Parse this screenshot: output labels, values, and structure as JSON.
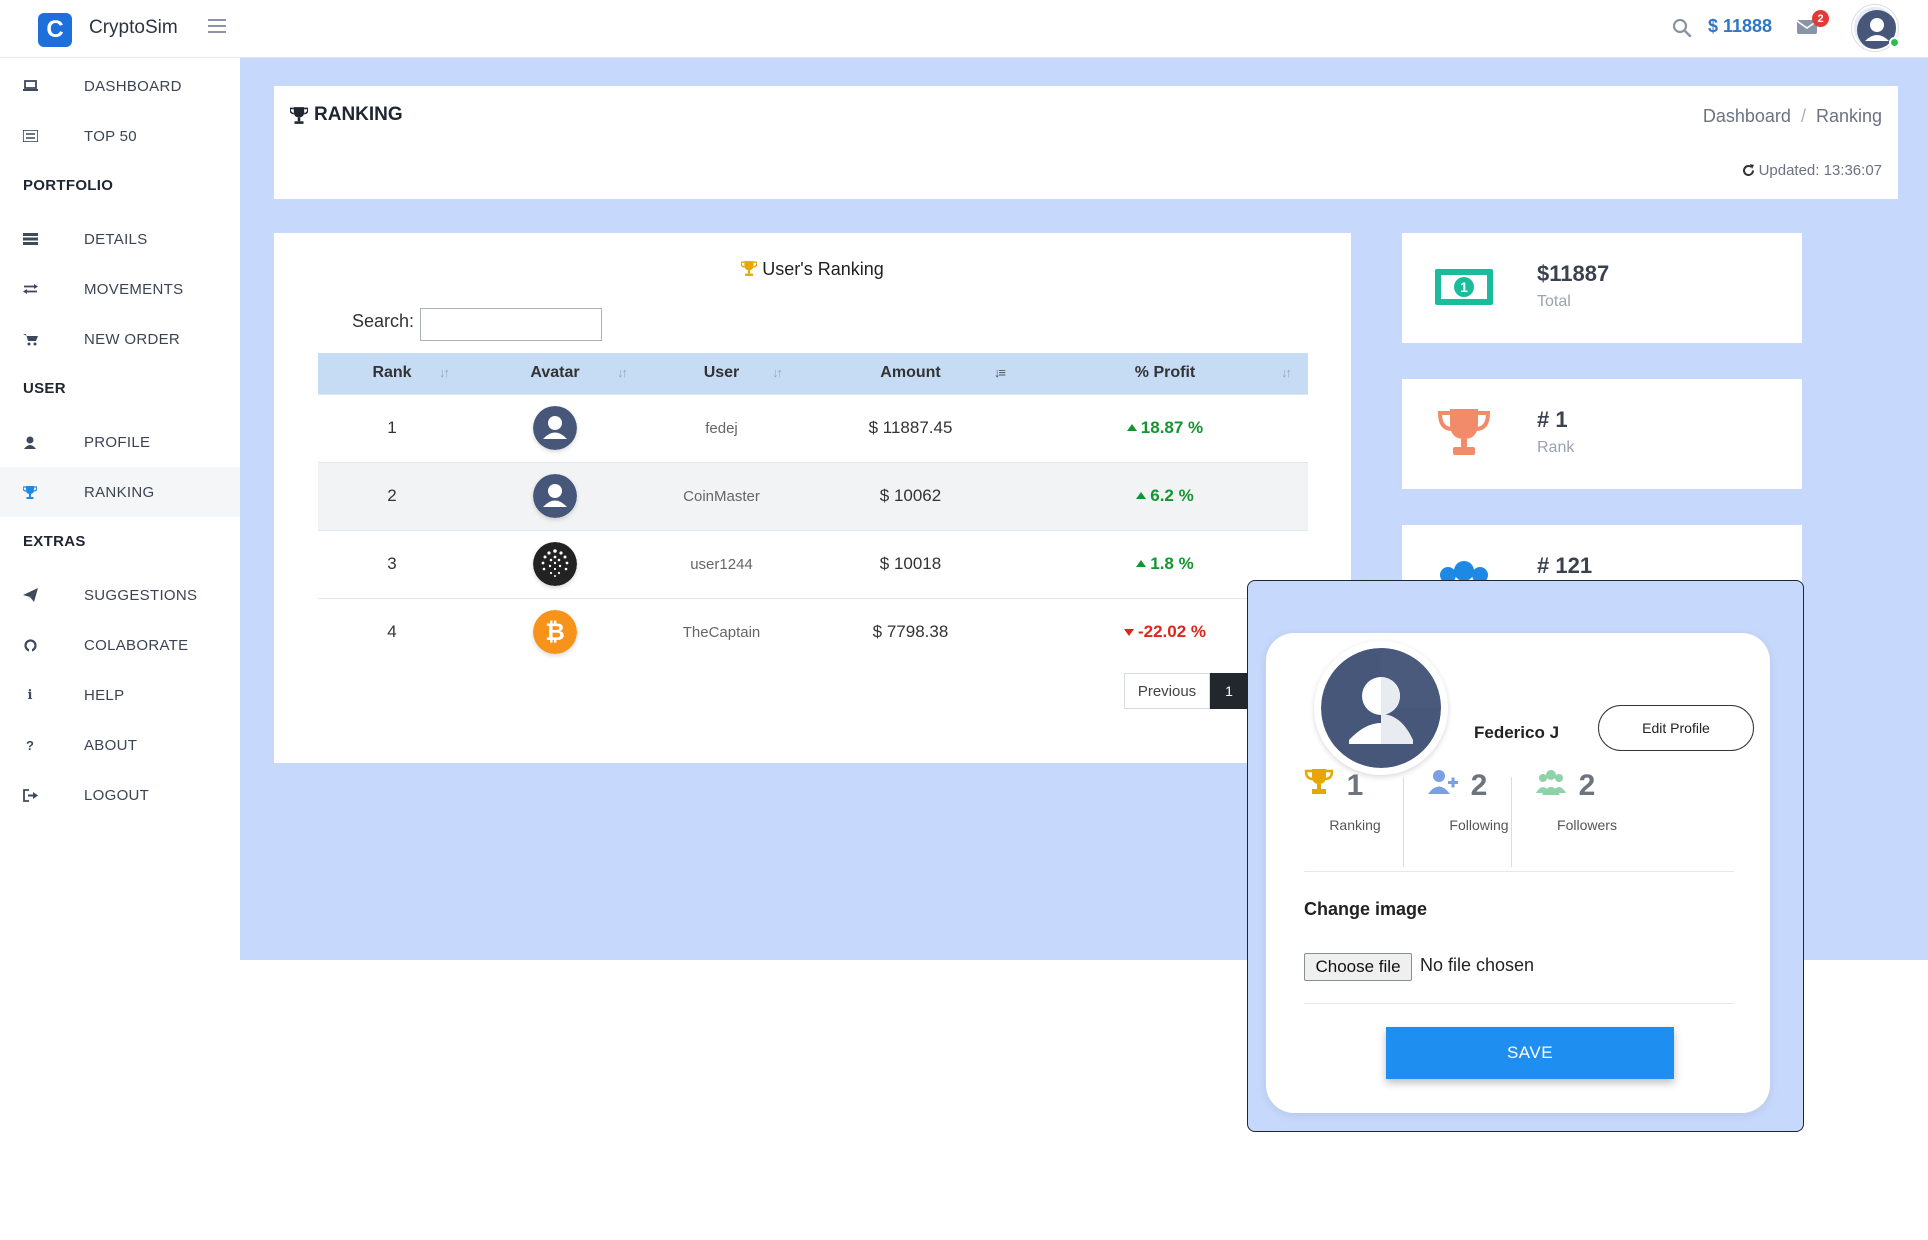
{
  "app": {
    "name": "CryptoSim",
    "logo_letter": "C",
    "brand_color": "#1e6fd9"
  },
  "topbar": {
    "balance": "$ 11888",
    "mail_count": "2"
  },
  "sidebar": {
    "items": [
      {
        "label": "DASHBOARD",
        "icon": "laptop-icon"
      },
      {
        "label": "TOP 50",
        "icon": "list-icon"
      }
    ],
    "sections": [
      {
        "title": "PORTFOLIO",
        "items": [
          {
            "label": "DETAILS",
            "icon": "tasks-icon"
          },
          {
            "label": "MOVEMENTS",
            "icon": "exchange-icon"
          },
          {
            "label": "NEW ORDER",
            "icon": "cart-icon"
          }
        ]
      },
      {
        "title": "USER",
        "items": [
          {
            "label": "PROFILE",
            "icon": "user-icon"
          },
          {
            "label": "RANKING",
            "icon": "trophy-icon",
            "active": true
          }
        ]
      },
      {
        "title": "EXTRAS",
        "items": [
          {
            "label": "SUGGESTIONS",
            "icon": "paper-plane-icon"
          },
          {
            "label": "COLABORATE",
            "icon": "github-icon"
          },
          {
            "label": "HELP",
            "icon": "info-icon"
          },
          {
            "label": "ABOUT",
            "icon": "question-icon"
          },
          {
            "label": "LOGOUT",
            "icon": "sign-out-icon"
          }
        ]
      }
    ]
  },
  "header": {
    "title": "RANKING",
    "breadcrumb": [
      "Dashboard",
      "Ranking"
    ],
    "breadcrumb_sep": "/",
    "updated": "Updated: 13:36:07"
  },
  "ranking_table": {
    "title": "User's Ranking",
    "search_label": "Search:",
    "search_value": "",
    "columns": [
      "Rank",
      "Avatar",
      "User",
      "Amount",
      "% Profit"
    ],
    "rows": [
      {
        "rank": "1",
        "avatar": "default-user",
        "user": "fedej",
        "amount": "$ 11887.45",
        "profit": "18.87 %",
        "trend": "up"
      },
      {
        "rank": "2",
        "avatar": "default-user",
        "user": "CoinMaster",
        "amount": "$ 10062",
        "profit": "6.2 %",
        "trend": "up"
      },
      {
        "rank": "3",
        "avatar": "iota-coin",
        "user": "user1244",
        "amount": "$ 10018",
        "profit": "1.8 %",
        "trend": "up"
      },
      {
        "rank": "4",
        "avatar": "bitcoin-coin",
        "user": "TheCaptain",
        "amount": "$ 7798.38",
        "profit": "-22.02 %",
        "trend": "down"
      }
    ],
    "pager": {
      "previous": "Previous",
      "current_page": "1"
    }
  },
  "stats": [
    {
      "value": "$11887",
      "label": "Total",
      "icon": "money-bill-icon",
      "color": "#1abc9c"
    },
    {
      "value": "# 1",
      "label": "Rank",
      "icon": "trophy-icon",
      "color": "#f28b6a"
    },
    {
      "value": "# 121",
      "label": "",
      "icon": "users-icon",
      "color": "#1e88e5"
    }
  ],
  "profile_popup": {
    "name": "Federico J",
    "edit_label": "Edit Profile",
    "stats": [
      {
        "value": "1",
        "label": "Ranking",
        "icon": "trophy-icon",
        "color": "#e6a700"
      },
      {
        "value": "2",
        "label": "Following",
        "icon": "user-plus-icon",
        "color": "#7b9fe0"
      },
      {
        "value": "2",
        "label": "Followers",
        "icon": "users-icon",
        "color": "#8fd1a8"
      }
    ],
    "change_image_label": "Change image",
    "choose_file_label": "Choose file",
    "file_status": "No file chosen",
    "save_label": "SAVE"
  }
}
